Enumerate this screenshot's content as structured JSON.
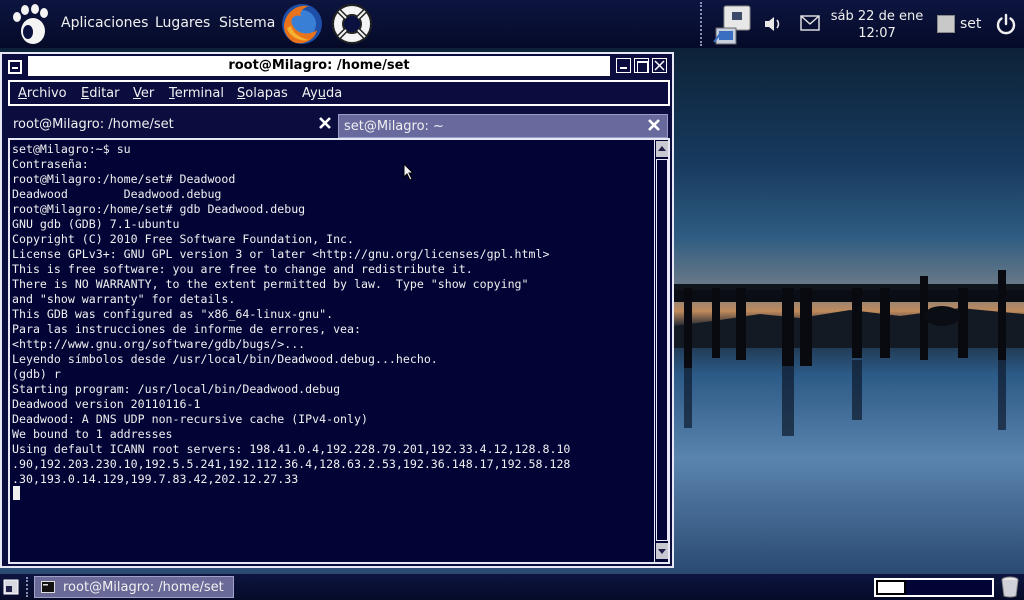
{
  "top_panel": {
    "menus": {
      "apps": "Aplicaciones",
      "places": "Lugares",
      "system": "Sistema"
    },
    "launchers": [
      "firefox-icon",
      "help-lifebuoy-icon"
    ],
    "tray": [
      "network-icon",
      "volume-icon",
      "mail-icon"
    ],
    "clock": {
      "date": "sáb 22 de ene",
      "time": "12:07"
    },
    "user": "set"
  },
  "window": {
    "title": "root@Milagro: /home/set",
    "menubar": [
      {
        "label": "Archivo",
        "accel": "A",
        "rest": "rchivo"
      },
      {
        "label": "Editar",
        "accel": "E",
        "rest": "ditar"
      },
      {
        "label": "Ver",
        "accel": "V",
        "rest": "er"
      },
      {
        "label": "Terminal",
        "accel": "T",
        "rest": "erminal"
      },
      {
        "label": "Solapas",
        "accel": "S",
        "rest": "olapas"
      },
      {
        "label": "Ayuda",
        "accel": "u",
        "pre": "Ay",
        "rest": "da"
      }
    ],
    "tabs": [
      {
        "label": "root@Milagro: /home/set",
        "active": true
      },
      {
        "label": "set@Milagro: ~",
        "active": false
      }
    ],
    "terminal_lines": [
      "set@Milagro:~$ su",
      "Contraseña:",
      "root@Milagro:/home/set# Deadwood",
      "Deadwood        Deadwood.debug",
      "root@Milagro:/home/set# gdb Deadwood.debug",
      "GNU gdb (GDB) 7.1-ubuntu",
      "Copyright (C) 2010 Free Software Foundation, Inc.",
      "License GPLv3+: GNU GPL version 3 or later <http://gnu.org/licenses/gpl.html>",
      "This is free software: you are free to change and redistribute it.",
      "There is NO WARRANTY, to the extent permitted by law.  Type \"show copying\"",
      "and \"show warranty\" for details.",
      "This GDB was configured as \"x86_64-linux-gnu\".",
      "Para las instrucciones de informe de errores, vea:",
      "<http://www.gnu.org/software/gdb/bugs/>...",
      "Leyendo símbolos desde /usr/local/bin/Deadwood.debug...hecho.",
      "(gdb) r",
      "Starting program: /usr/local/bin/Deadwood.debug",
      "Deadwood version 20110116-1",
      "Deadwood: A DNS UDP non-recursive cache (IPv4-only)",
      "We bound to 1 addresses",
      "Using default ICANN root servers: 198.41.0.4,192.228.79.201,192.33.4.12,128.8.10",
      ".90,192.203.230.10,192.5.5.241,192.112.36.4,128.63.2.53,192.36.148.17,192.58.128",
      ".30,193.0.14.129,199.7.83.42,202.12.27.33"
    ]
  },
  "bottom_panel": {
    "task": "root@Milagro: /home/set",
    "workspaces": 2
  }
}
